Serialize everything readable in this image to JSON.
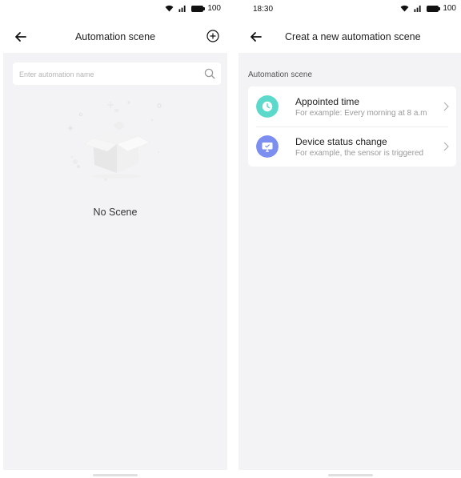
{
  "left_screen": {
    "status": {
      "battery": "100"
    },
    "header": {
      "title": "Automation scene"
    },
    "search": {
      "placeholder": "Enter automation name"
    },
    "empty_text": "No Scene"
  },
  "right_screen": {
    "status": {
      "time": "18:30",
      "battery": "100"
    },
    "header": {
      "title": "Creat a new automation scene"
    },
    "section_label": "Automation scene",
    "items": [
      {
        "title": "Appointed time",
        "subtitle": "For example: Every morning at 8 a.m",
        "icon": "clock-icon",
        "color": "#5dd9cc"
      },
      {
        "title": "Device status change",
        "subtitle": "For example, the sensor is triggered",
        "icon": "device-icon",
        "color": "#7c8ff0"
      }
    ]
  },
  "colors": {
    "background": "#f3f3f5",
    "card": "#ffffff",
    "accent_teal": "#5dd9cc",
    "accent_purple": "#7c8ff0"
  }
}
